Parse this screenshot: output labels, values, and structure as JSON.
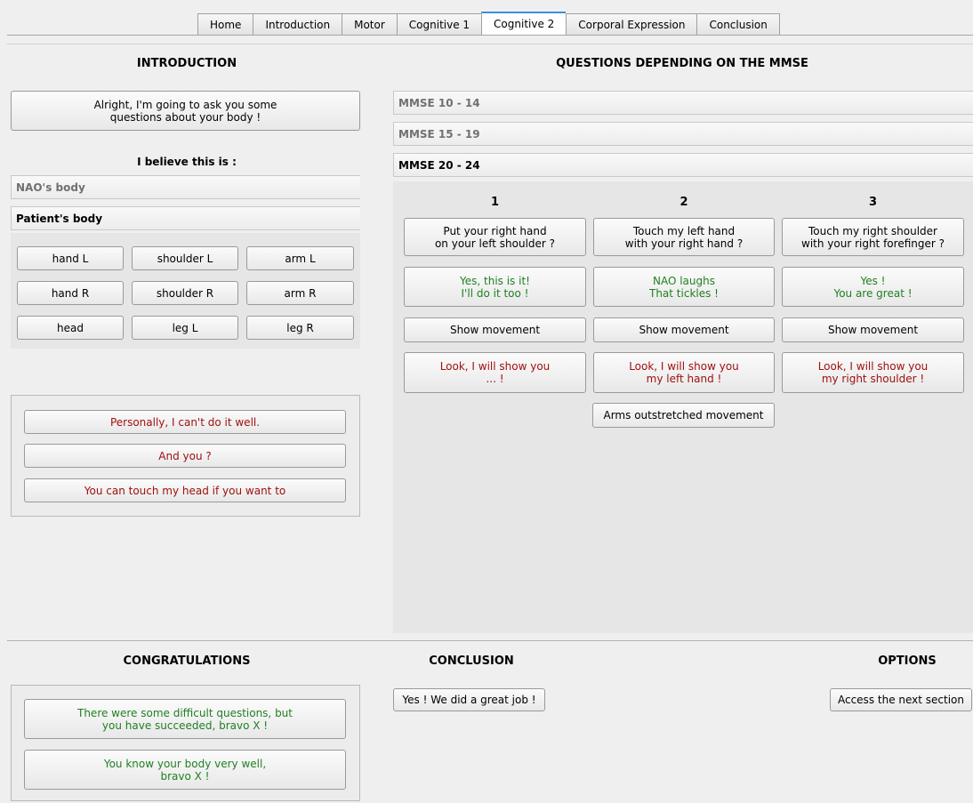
{
  "tabs": [
    "Home",
    "Introduction",
    "Motor",
    "Cognitive 1",
    "Cognitive 2",
    "Corporal Expression",
    "Conclusion"
  ],
  "active_tab": "Cognitive 2",
  "intro": {
    "heading": "INTRODUCTION",
    "prompt_button": "Alright, I'm going to ask you some\nquestions about your body !",
    "believe_label": "I believe this is :",
    "nao_body": "NAO's body",
    "patient_body": "Patient's body",
    "body_parts": [
      "hand L",
      "shoulder L",
      "arm L",
      "hand R",
      "shoulder R",
      "arm R",
      "head",
      "leg L",
      "leg R"
    ],
    "remarks": [
      "Personally, I can't do it well.",
      "And you ?",
      "You can touch my head if you want to"
    ]
  },
  "questions": {
    "heading": "QUESTIONS DEPENDING ON THE MMSE",
    "sections": [
      "MMSE 10 - 14",
      "MMSE 15 - 19",
      "MMSE 20 - 24"
    ],
    "columns": [
      {
        "number": "1",
        "question": "Put your right hand\non your left shoulder ?",
        "reply": "Yes, this is it!\nI'll do it too !",
        "show": "Show movement",
        "look": "Look, I will show you\n... !"
      },
      {
        "number": "2",
        "question": "Touch my left hand\nwith your right hand ?",
        "reply": "NAO laughs\nThat tickles !",
        "show": "Show movement",
        "look": "Look, I will show you\nmy left hand !",
        "extra": "Arms outstretched movement"
      },
      {
        "number": "3",
        "question": "Touch my right shoulder\nwith your right forefinger ?",
        "reply": "Yes !\nYou are great !",
        "show": "Show movement",
        "look": "Look, I will show you\nmy right shoulder !"
      }
    ]
  },
  "congrats": {
    "heading": "CONGRATULATIONS",
    "messages": [
      "There were some difficult questions, but\nyou have succeeded, bravo X !",
      "You know your body very well,\nbravo X !"
    ]
  },
  "conclusion": {
    "heading": "CONCLUSION",
    "button": "Yes ! We did a great job !"
  },
  "options": {
    "heading": "OPTIONS",
    "button": "Access the next section"
  }
}
